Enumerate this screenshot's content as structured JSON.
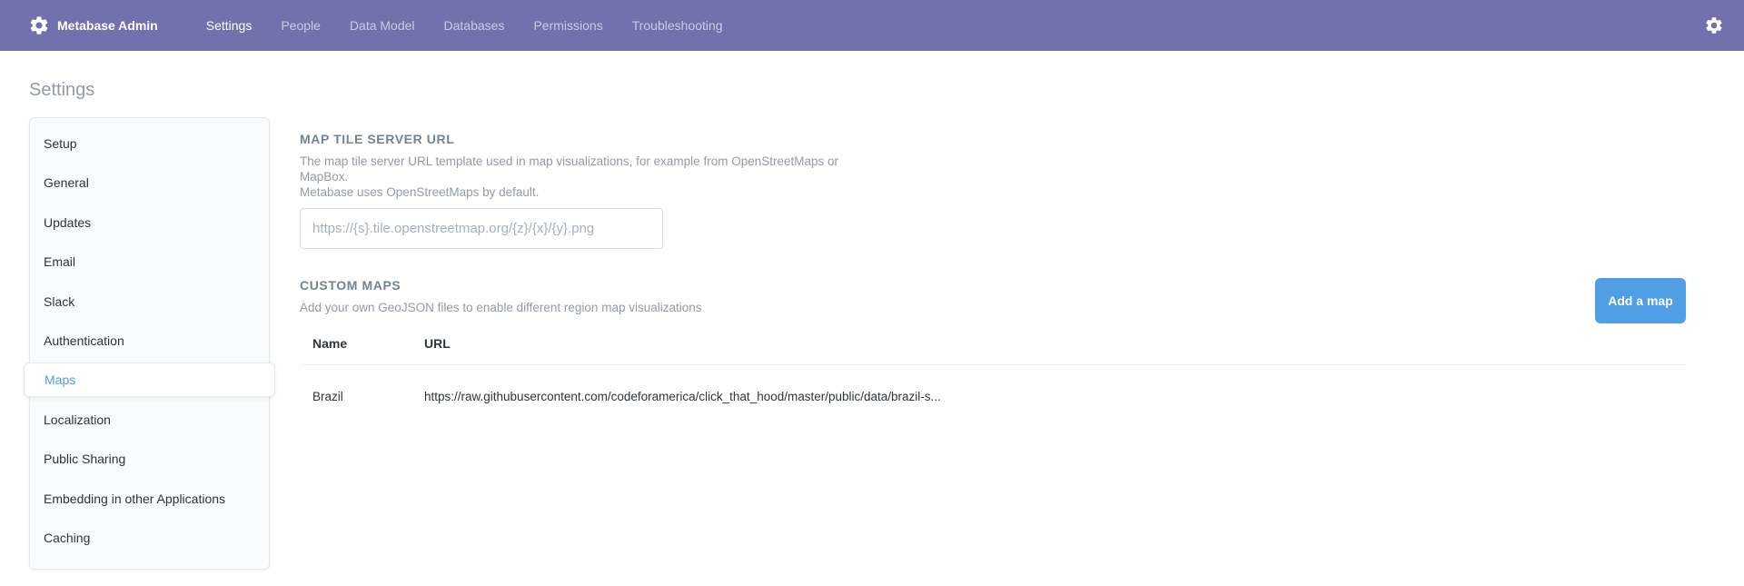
{
  "app": {
    "brand_title": "Metabase Admin",
    "accent_color": "#509ee3",
    "nav_color": "#7172ad"
  },
  "nav": {
    "links": [
      {
        "label": "Settings",
        "active": true
      },
      {
        "label": "People"
      },
      {
        "label": "Data Model"
      },
      {
        "label": "Databases"
      },
      {
        "label": "Permissions"
      },
      {
        "label": "Troubleshooting"
      }
    ],
    "icons": {
      "brand": "gear-icon",
      "settings": "gear-icon"
    }
  },
  "page": {
    "title": "Settings"
  },
  "sidebar": {
    "items": [
      {
        "label": "Setup"
      },
      {
        "label": "General"
      },
      {
        "label": "Updates"
      },
      {
        "label": "Email"
      },
      {
        "label": "Slack"
      },
      {
        "label": "Authentication"
      },
      {
        "label": "Maps",
        "active": true
      },
      {
        "label": "Localization"
      },
      {
        "label": "Public Sharing"
      },
      {
        "label": "Embedding in other Applications"
      },
      {
        "label": "Caching"
      }
    ]
  },
  "tile_server": {
    "label": "MAP TILE SERVER URL",
    "desc_line1": "The map tile server URL template used in map visualizations, for example from OpenStreetMaps or",
    "desc_line2": "MapBox.",
    "desc_line3": "Metabase uses OpenStreetMaps by default.",
    "placeholder": "https://{s}.tile.openstreetmap.org/{z}/{x}/{y}.png",
    "value": ""
  },
  "custom_maps": {
    "label": "CUSTOM MAPS",
    "description": "Add your own GeoJSON files to enable different region map visualizations",
    "add_button": "Add a map",
    "columns": [
      "Name",
      "URL"
    ],
    "rows": [
      {
        "name": "Brazil",
        "url": "https://raw.githubusercontent.com/codeforamerica/click_that_hood/master/public/data/brazil-s..."
      }
    ]
  }
}
